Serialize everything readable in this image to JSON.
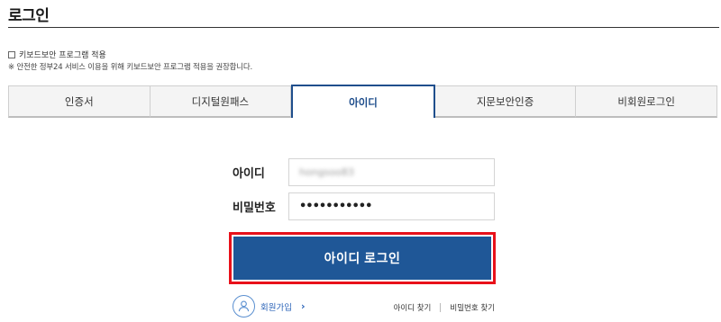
{
  "page": {
    "title": "로그인"
  },
  "keyboard_security": {
    "checkbox_label": "키보드보안 프로그램 적용",
    "checked": false,
    "note": "※ 안전한 정부24 서비스 이용을 위해 키보드보안 프로그램 적용을 권장합니다."
  },
  "tabs": [
    {
      "label": "인증서",
      "active": false
    },
    {
      "label": "디지털원패스",
      "active": false
    },
    {
      "label": "아이디",
      "active": true
    },
    {
      "label": "지문보안인증",
      "active": false
    },
    {
      "label": "비회원로그인",
      "active": false
    }
  ],
  "form": {
    "id_label": "아이디",
    "id_value": "hongsoo83",
    "password_label": "비밀번호",
    "password_value": "•••••••••••"
  },
  "login_button": {
    "label": "아이디 로그인"
  },
  "footer": {
    "join_label": "회원가입",
    "join_icon": "person-icon",
    "chevron": "›",
    "find_id": "아이디 찾기",
    "find_password": "비밀번호 찾기"
  },
  "colors": {
    "accent": "#1f5797",
    "active_tab_border": "#1f4e8c",
    "highlight_outline": "#e8111a",
    "link": "#2a63b8"
  }
}
